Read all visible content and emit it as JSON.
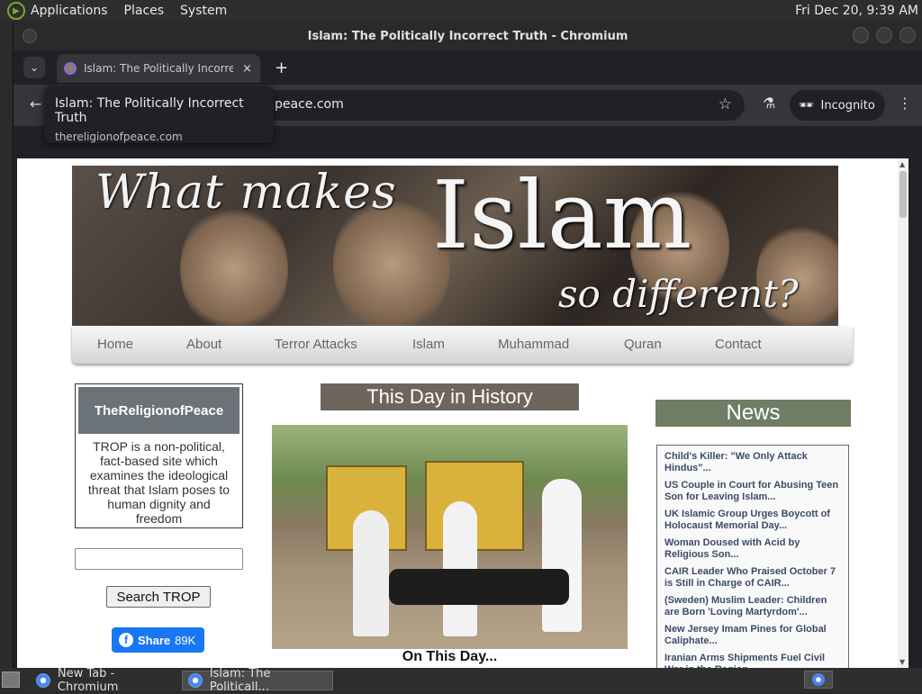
{
  "system_panel": {
    "menus": [
      "Applications",
      "Places",
      "System"
    ],
    "clock": "Fri Dec 20,  9:39 AM"
  },
  "window": {
    "title": "Islam: The Politically Incorrect Truth - Chromium"
  },
  "tab": {
    "title": "Islam: The Politically Incorrect Truth",
    "close": "×",
    "new_tab": "+"
  },
  "toolbar": {
    "url_visible": "peace.com",
    "incognito_label": "Incognito"
  },
  "hover_card": {
    "title": "Islam: The Politically Incorrect Truth",
    "domain": "thereligionofpeace.com"
  },
  "banner": {
    "line1": "What makes",
    "line2": "Islam",
    "line3": "so different?"
  },
  "nav": {
    "items": [
      "Home",
      "About",
      "Terror Attacks",
      "Islam",
      "Muhammad",
      "Quran",
      "Contact"
    ]
  },
  "about": {
    "header": "TheReligionofPeace",
    "description": "TROP is a non-political, fact-based site which examines the ideological threat that Islam poses to human dignity and freedom"
  },
  "search": {
    "placeholder": "",
    "button_label": "Search TROP"
  },
  "facebook": {
    "label": "Share",
    "count": "89K",
    "icon": "f"
  },
  "history": {
    "title": "This Day in History",
    "caption": "On This Day..."
  },
  "news": {
    "title": "News",
    "items": [
      "Child's Killer: \"We Only Attack Hindus\"...",
      "US Couple in Court for Abusing Teen Son for Leaving Islam...",
      "UK Islamic Group Urges Boycott of Holocaust Memorial Day...",
      "Woman Doused with Acid by Religious Son...",
      "CAIR Leader Who Praised October 7 is Still in Charge of CAIR...",
      "(Sweden) Muslim Leader: Children are Born 'Loving Martyrdom'...",
      "New Jersey Imam Pines for Global Caliphate...",
      "Iranian Arms Shipments Fuel Civil War in the Region..."
    ]
  },
  "taskbar": {
    "tasks": [
      "New Tab - Chromium",
      "Islam: The Politicall..."
    ]
  }
}
